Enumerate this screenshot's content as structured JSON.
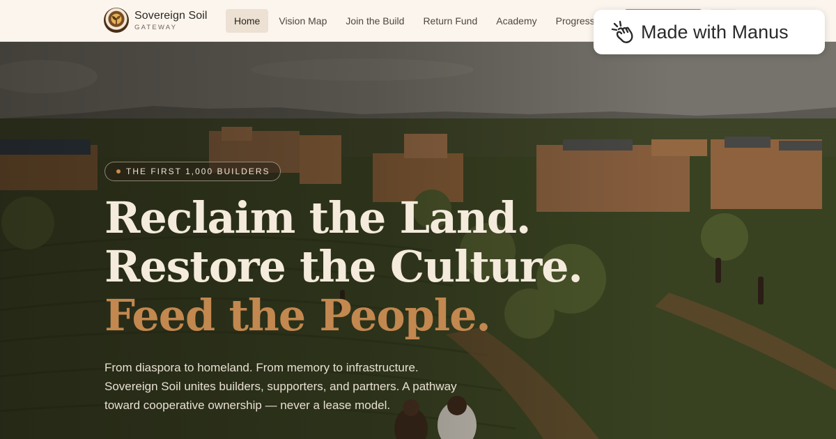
{
  "brand": {
    "name": "Sovereign Soil",
    "tagline": "GATEWAY"
  },
  "nav": {
    "items": [
      {
        "label": "Home",
        "active": true
      },
      {
        "label": "Vision Map",
        "active": false
      },
      {
        "label": "Join the Build",
        "active": false
      },
      {
        "label": "Return Fund",
        "active": false
      },
      {
        "label": "Academy",
        "active": false
      },
      {
        "label": "Progress",
        "active": false
      }
    ]
  },
  "badge": {
    "label": "Made with Manus",
    "icon": "manus-hand-icon"
  },
  "hero": {
    "eyebrow": "THE FIRST 1,000 BUILDERS",
    "headline": {
      "line1": "Reclaim the Land.",
      "line2": "Restore the Culture.",
      "line3": "Feed the People."
    },
    "lede_lines": [
      "From diaspora to homeland. From memory to infrastructure.",
      "Sovereign Soil unites builders, supporters, and partners. A pathway",
      "toward cooperative ownership — never a lease model."
    ]
  },
  "colors": {
    "nav_bg": "#fbf5ee",
    "accent": "#c2884f",
    "headline": "#f4ebdc",
    "cta": "#b97a45"
  }
}
